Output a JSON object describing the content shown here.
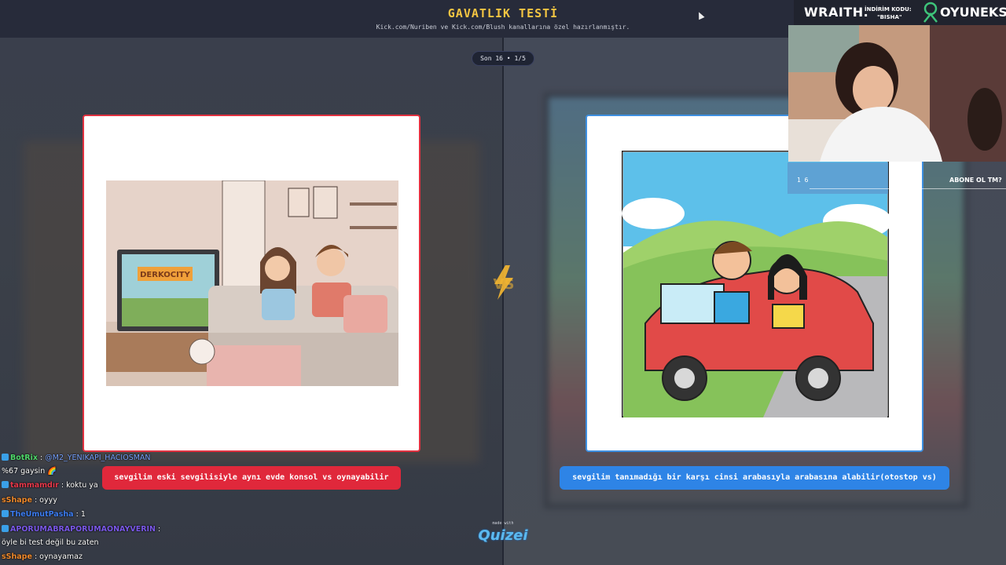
{
  "header": {
    "title": "GAVATLIK TESTİ",
    "subtitle": "Kick.com/Nuriben ve Kick.com/Blush kanallarına özel hazırlanmıştır."
  },
  "progress": "Son 16 • 1/5",
  "vs_label": "VS",
  "options": {
    "left": {
      "answer": "sevgilim eski sevgilisiyle aynı evde konsol vs oynayabilir",
      "game_title": "DERKOCITY",
      "accent": "#e0283b"
    },
    "right": {
      "answer": "sevgilim tanımadığı bir karşı cinsi arabasıyla arabasına alabilir(otostop vs)",
      "accent": "#2e84e6"
    }
  },
  "footer": {
    "made_with": "made with",
    "brand": "Quizei"
  },
  "sponsor": {
    "wraith": "WRAITH.",
    "promo_label": "İNDİRİM KODU:",
    "promo_code": "\"BISHA\"",
    "partner": "OYUNEKS"
  },
  "stream_overlay": {
    "subscribe": "ABONE OL TM?",
    "counter": "1 6"
  },
  "chat": [
    {
      "user": "BotRix",
      "color": "green",
      "sep": " : ",
      "message": "@M2_YENIKAPI_HACIOSMAN",
      "mention": true
    },
    {
      "user": "",
      "color": "",
      "sep": "",
      "message": "%67 gaysin 🌈",
      "mention": false
    },
    {
      "user": "tammamdır",
      "color": "red",
      "sep": " : ",
      "message": "koktu ya",
      "mention": false
    },
    {
      "user": "sShape",
      "color": "orange",
      "sep": " : ",
      "message": "oyyy",
      "mention": false
    },
    {
      "user": "TheUmutPasha",
      "color": "blue",
      "sep": " : ",
      "message": "1",
      "mention": false
    },
    {
      "user": "APORUMABRAPORUMAONAYVERIN",
      "color": "purple",
      "sep": " :",
      "message": "",
      "mention": false
    },
    {
      "user": "",
      "color": "",
      "sep": "",
      "message": "öyle bi test değil bu zaten",
      "mention": false
    },
    {
      "user": "sShape",
      "color": "orange",
      "sep": " : ",
      "message": "oynayamaz",
      "mention": false
    }
  ]
}
